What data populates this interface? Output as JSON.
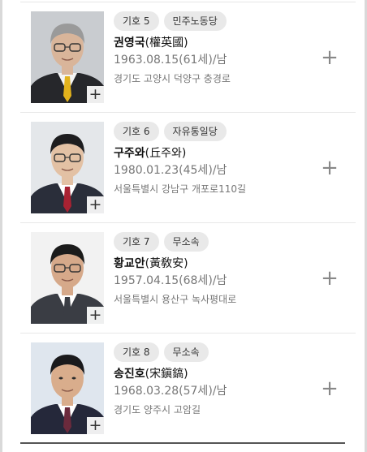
{
  "candidates": [
    {
      "number": "기호 5",
      "party": "민주노동당",
      "name": "권영국",
      "hanja": "(權英國)",
      "birth": "1963.08.15(61세)/남",
      "address": "경기도 고양시 덕양구 충경로",
      "photo": {
        "bg": "#c9ccd0",
        "hair": "#9a9a9a",
        "skin": "#d9b59a",
        "suit": "#26272b",
        "shirt": "#f4f4f4",
        "tie": "#e2b21c",
        "glasses": true
      }
    },
    {
      "number": "기호 6",
      "party": "자유통일당",
      "name": "구주와",
      "hanja": "(丘주와)",
      "birth": "1980.01.23(45세)/남",
      "address": "서울특별시 강남구 개포로110길",
      "photo": {
        "bg": "#e4e7ea",
        "hair": "#1d1d1f",
        "skin": "#e3c1a4",
        "suit": "#2a2e3a",
        "shirt": "#ffffff",
        "tie": "#a82232",
        "glasses": true
      }
    },
    {
      "number": "기호 7",
      "party": "무소속",
      "name": "황교안",
      "hanja": "(黃敎安)",
      "birth": "1957.04.15(68세)/남",
      "address": "서울특별시 용산구 녹사평대로",
      "photo": {
        "bg": "#f2f2f2",
        "hair": "#1b1b1b",
        "skin": "#d6a98a",
        "suit": "#3a3d44",
        "shirt": "#ffffff",
        "tie": "#3a3d44",
        "glasses": true
      }
    },
    {
      "number": "기호 8",
      "party": "무소속",
      "name": "송진호",
      "hanja": "(宋鎭鎬)",
      "birth": "1968.03.28(57세)/남",
      "address": "경기도 양주시 고암길",
      "photo": {
        "bg": "#dfe6ee",
        "hair": "#1a1a1c",
        "skin": "#d9ad8c",
        "suit": "#25283a",
        "shirt": "#ffffff",
        "tie": "#6b2a3c",
        "glasses": false
      }
    }
  ],
  "photo_plus_symbol": "+",
  "expand_symbol": "+",
  "icons": {
    "photo_zoom": "plus-icon",
    "expand": "plus-icon"
  }
}
